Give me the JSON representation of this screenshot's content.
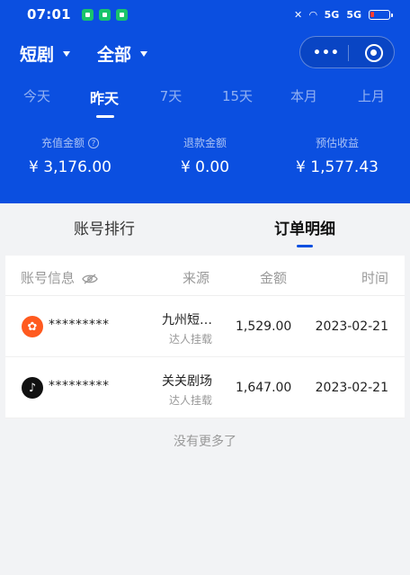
{
  "status_bar": {
    "time": "07:01",
    "network": "5G"
  },
  "header": {
    "category_label": "短剧",
    "filter_label": "全部"
  },
  "time_tabs": [
    {
      "label": "今天",
      "active": false
    },
    {
      "label": "昨天",
      "active": true
    },
    {
      "label": "7天",
      "active": false
    },
    {
      "label": "15天",
      "active": false
    },
    {
      "label": "本月",
      "active": false
    },
    {
      "label": "上月",
      "active": false
    }
  ],
  "stats": [
    {
      "label": "充值金额",
      "value": "¥ 3,176.00"
    },
    {
      "label": "退款金额",
      "value": "¥ 0.00"
    },
    {
      "label": "预估收益",
      "value": "¥ 1,577.43"
    }
  ],
  "main_tabs": [
    {
      "label": "账号排行",
      "active": false
    },
    {
      "label": "订单明细",
      "active": true
    }
  ],
  "table": {
    "headers": {
      "account": "账号信息",
      "source": "来源",
      "amount": "金额",
      "time": "时间"
    },
    "rows": [
      {
        "avatar": "kuaishou-icon",
        "account": "*********",
        "source": "九州短…",
        "source_sub": "达人挂载",
        "amount": "1,529.00",
        "date": "2023-02-21"
      },
      {
        "avatar": "douyin-icon",
        "account": "*********",
        "source": "关关剧场",
        "source_sub": "达人挂载",
        "amount": "1,647.00",
        "date": "2023-02-21"
      }
    ]
  },
  "footer": {
    "no_more": "没有更多了"
  },
  "colors": {
    "brand": "#0b4fe0",
    "kuaishou": "#ff5a1f",
    "douyin": "#111111"
  }
}
